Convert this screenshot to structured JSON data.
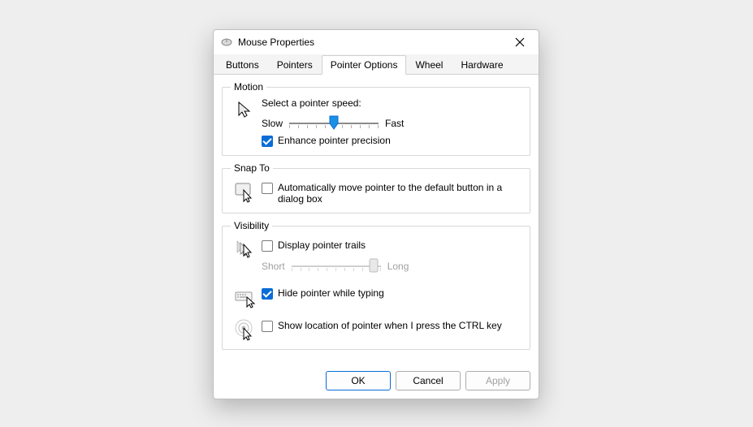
{
  "window": {
    "title": "Mouse Properties"
  },
  "tabs": {
    "items": [
      "Buttons",
      "Pointers",
      "Pointer Options",
      "Wheel",
      "Hardware"
    ],
    "active_index": 2
  },
  "motion": {
    "legend": "Motion",
    "speed_label": "Select a pointer speed:",
    "slow": "Slow",
    "fast": "Fast",
    "speed_value": 6,
    "speed_min": 1,
    "speed_max": 11,
    "enhance_label": "Enhance pointer precision",
    "enhance_checked": true
  },
  "snapto": {
    "legend": "Snap To",
    "auto_label": "Automatically move pointer to the default button in a dialog box",
    "auto_checked": false
  },
  "visibility": {
    "legend": "Visibility",
    "trails_label": "Display pointer trails",
    "trails_checked": false,
    "trails_short": "Short",
    "trails_long": "Long",
    "trails_value": 10,
    "trails_enabled": false,
    "hide_label": "Hide pointer while typing",
    "hide_checked": true,
    "ctrl_label": "Show location of pointer when I press the CTRL key",
    "ctrl_checked": false
  },
  "buttons": {
    "ok": "OK",
    "cancel": "Cancel",
    "apply": "Apply",
    "apply_enabled": false
  }
}
